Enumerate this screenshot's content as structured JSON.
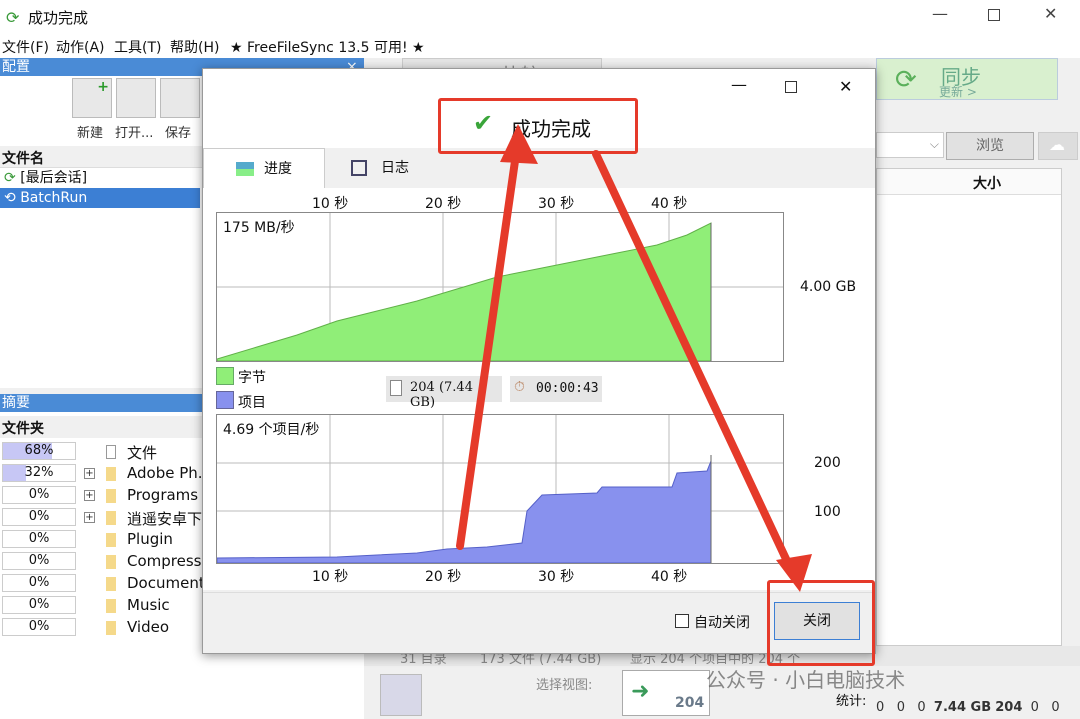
{
  "window": {
    "title": "成功完成"
  },
  "menu": [
    "文件(F)",
    "动作(A)",
    "工具(T)",
    "帮助(H)",
    "★ FreeFileSync 13.5 可用! ★"
  ],
  "config": {
    "header": "配置",
    "tools": [
      "新建",
      "打开...",
      "保存"
    ],
    "column": "文件名",
    "items": [
      "[最后会话]",
      "BatchRun"
    ]
  },
  "summary": {
    "header": "摘要",
    "column": "文件夹",
    "rows": [
      {
        "pct": "68%",
        "fill": 0.68,
        "name": "文件",
        "expandable": false
      },
      {
        "pct": "32%",
        "fill": 0.32,
        "name": "Adobe Ph...",
        "expandable": true
      },
      {
        "pct": "0%",
        "fill": 0,
        "name": "Programs",
        "expandable": true
      },
      {
        "pct": "0%",
        "fill": 0,
        "name": "逍遥安卓下",
        "expandable": true
      },
      {
        "pct": "0%",
        "fill": 0,
        "name": "Plugin",
        "expandable": false
      },
      {
        "pct": "0%",
        "fill": 0,
        "name": "Compresse",
        "expandable": false
      },
      {
        "pct": "0%",
        "fill": 0,
        "name": "Document",
        "expandable": false
      },
      {
        "pct": "0%",
        "fill": 0,
        "name": "Music",
        "expandable": false
      },
      {
        "pct": "0%",
        "fill": 0,
        "name": "Video",
        "expandable": false
      }
    ]
  },
  "background": {
    "compare": "比较",
    "sync_main": "同步",
    "sync_sub": "更新 >",
    "browse": "浏览",
    "size_col": "大小",
    "status_left": "31 目录",
    "status_mid": "173 文件 (7.44 GB)",
    "status_right": "显示 204 个项目中的 204 个",
    "select_view": "选择视图:",
    "view_count": "204",
    "stats_label": "统计:",
    "stats_values": [
      "0",
      "0",
      "0",
      "7.44 GB",
      "204",
      "0",
      "0"
    ],
    "watermark": "公众号 · 小白电脑技术"
  },
  "dialog": {
    "heading": "成功完成",
    "tabs": [
      "进度",
      "日志"
    ],
    "time_ticks": [
      "10 秒",
      "20 秒",
      "30 秒",
      "40 秒"
    ],
    "bytes": {
      "rate": "175 MB/秒",
      "max_label": "4.00 GB",
      "legend": "字节",
      "color": "#90ee78"
    },
    "items": {
      "rate": "4.69 个项目/秒",
      "labels": [
        "200",
        "100"
      ],
      "legend": "项目",
      "color": "#8891ee"
    },
    "file_stat": "204 (7.44 GB)",
    "elapsed": "00:00:43",
    "auto_close": "自动关闭",
    "close": "关闭"
  }
}
